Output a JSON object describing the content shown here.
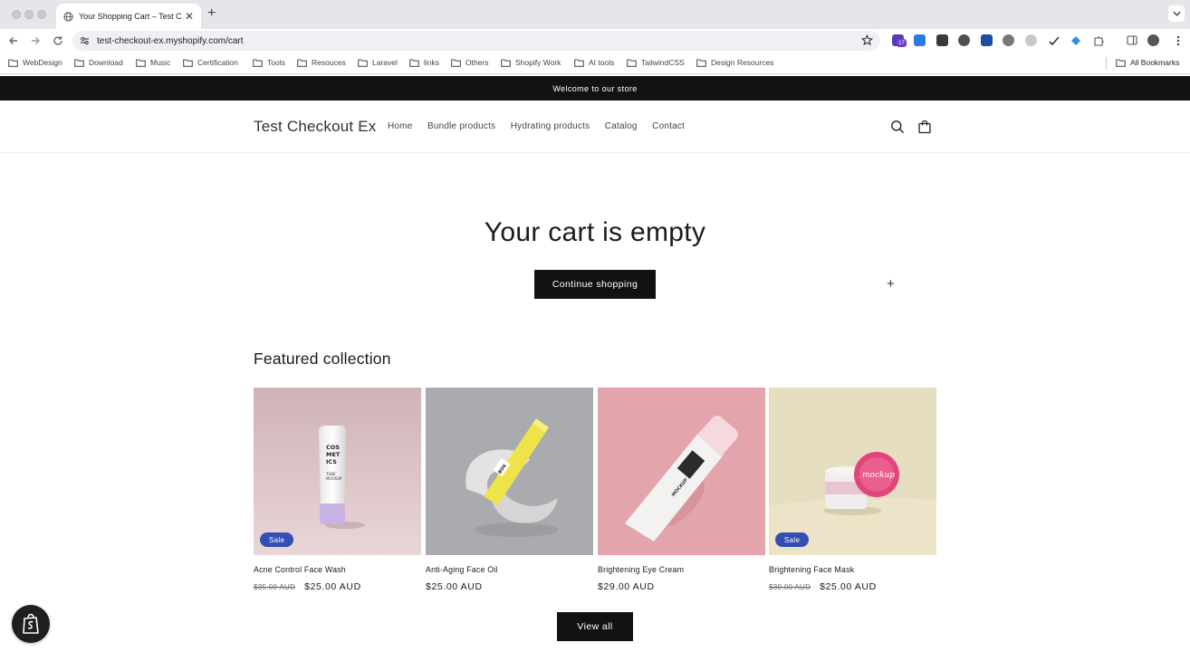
{
  "browser": {
    "tab_title": "Your Shopping Cart – Test Ch",
    "url": "test-checkout-ex.myshopify.com/cart",
    "extension_badge": "17",
    "bookmarks": [
      {
        "label": "WebDesign"
      },
      {
        "label": "Download"
      },
      {
        "label": "Music"
      },
      {
        "label": "Certification"
      },
      {
        "label": "Tools"
      },
      {
        "label": "Resouces"
      },
      {
        "label": "Laravel"
      },
      {
        "label": "links"
      },
      {
        "label": "Others"
      },
      {
        "label": "Shopify Work"
      },
      {
        "label": "AI tools"
      },
      {
        "label": "TailwindCSS"
      },
      {
        "label": "Design Resources"
      }
    ],
    "all_bookmarks": "All Bookmarks"
  },
  "store": {
    "announcement": "Welcome to our store",
    "logo": "Test Checkout Ex",
    "menu": [
      {
        "label": "Home"
      },
      {
        "label": "Bundle products"
      },
      {
        "label": "Hydrating products"
      },
      {
        "label": "Catalog"
      },
      {
        "label": "Contact"
      }
    ],
    "empty_title": "Your cart is empty",
    "continue_label": "Continue shopping",
    "featured_title": "Featured collection",
    "products": [
      {
        "title": "Acne Control Face Wash",
        "old_price": "$35.00 AUD",
        "price": "$25.00 AUD",
        "badge": "Sale"
      },
      {
        "title": "Anti-Aging Face Oil",
        "old_price": "",
        "price": "$25.00 AUD",
        "badge": ""
      },
      {
        "title": "Brightening Eye Cream",
        "old_price": "",
        "price": "$29.00 AUD",
        "badge": ""
      },
      {
        "title": "Brightening Face Mask",
        "old_price": "$30.00 AUD",
        "price": "$25.00 AUD",
        "badge": "Sale"
      }
    ],
    "view_all_label": "View all",
    "product_image_text": {
      "wash": [
        "COS",
        "MET",
        "ICS",
        "TUBE",
        "MOCKUP"
      ],
      "oil": "BOX",
      "cream": "MOCKUP",
      "mask": "mockup"
    }
  },
  "colors": {
    "announcement_bg": "#121212",
    "sale_badge": "#334fb4",
    "button_bg": "#121212"
  }
}
